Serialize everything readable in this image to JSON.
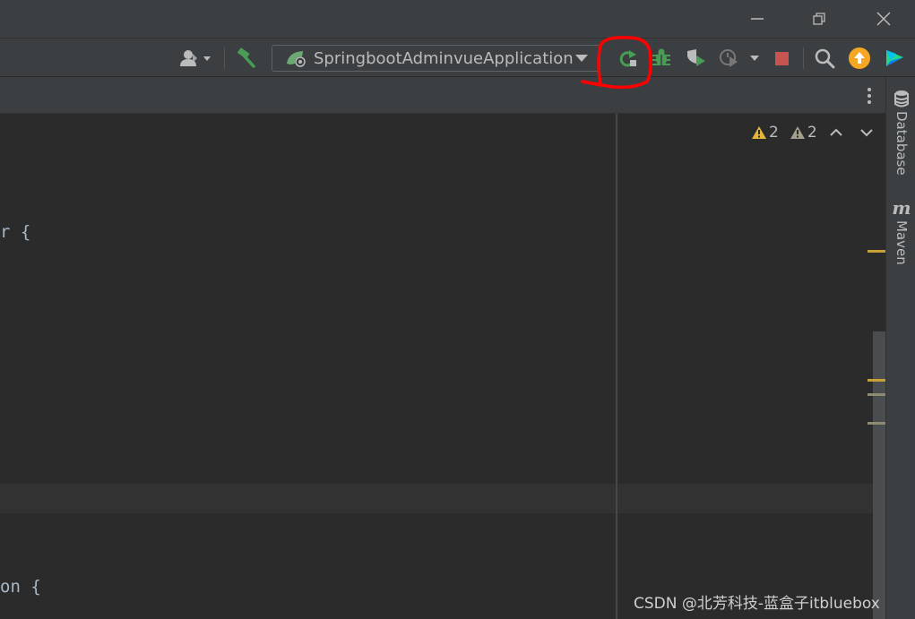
{
  "toolbar": {
    "run_config_label": "SpringbootAdminvueApplication"
  },
  "inspections": {
    "warnings_count": "2",
    "weak_warnings_count": "2"
  },
  "editor": {
    "code_line_1": "r {",
    "code_line_2": "on {"
  },
  "right_strip": {
    "database_label": "Database",
    "maven_icon_text": "m",
    "maven_label": "Maven"
  },
  "watermark": "CSDN @北芳科技-蓝盒子itbluebox",
  "colors": {
    "background": "#2b2b2b",
    "toolbar": "#3c3f41",
    "run_green": "#499c54",
    "stop_red": "#c75450",
    "warning_yellow": "#e6b33b",
    "update_orange": "#f5a623",
    "annotation_red": "#ff0000"
  },
  "icons": [
    "user-icon",
    "build-hammer-icon",
    "spring-boot-icon",
    "rerun-icon",
    "debug-bug-icon",
    "coverage-icon",
    "profiler-icon",
    "stop-icon",
    "search-icon",
    "update-icon",
    "jetbrains-toolbox-icon",
    "database-icon",
    "maven-icon"
  ]
}
